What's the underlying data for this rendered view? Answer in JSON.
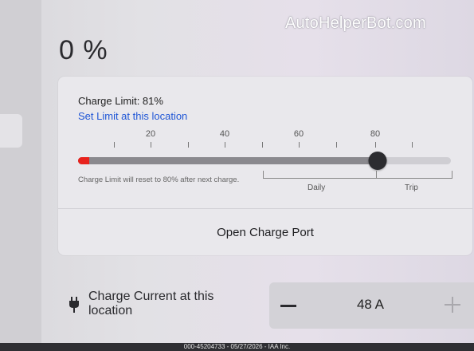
{
  "watermark": "AutoHelperBot.com",
  "battery": {
    "percent_text": "0 %"
  },
  "charge_panel": {
    "limit_label": "Charge Limit: 81%",
    "set_limit_link": "Set Limit at this location",
    "ticks": [
      "20",
      "40",
      "60",
      "80"
    ],
    "limit_value_percent": 81,
    "current_charge_percent": 0,
    "reset_note": "Charge Limit will reset to 80% after next charge.",
    "range_daily": "Daily",
    "range_trip": "Trip",
    "open_port_label": "Open Charge Port"
  },
  "charge_current": {
    "label": "Charge Current at this location",
    "value_text": "48  A",
    "icon": "plug-icon"
  },
  "footer": "000-45204733 - 05/27/2026 - IAA Inc.",
  "colors": {
    "accent_link": "#1f56d6",
    "current_charge": "#e8221d"
  }
}
